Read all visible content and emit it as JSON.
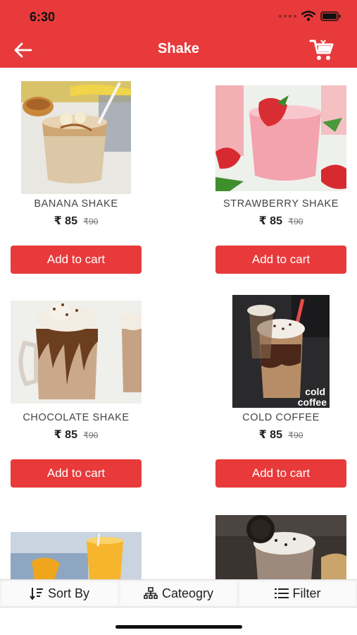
{
  "status": {
    "time": "6:30"
  },
  "header": {
    "title": "Shake"
  },
  "currency": "₹",
  "products": [
    {
      "name": "BANANA SHAKE",
      "price": "85",
      "old_price": "90",
      "button": "Add to cart"
    },
    {
      "name": "STRAWBERRY SHAKE",
      "price": "85",
      "old_price": "90",
      "button": "Add to cart"
    },
    {
      "name": "CHOCOLATE SHAKE",
      "price": "85",
      "old_price": "90",
      "button": "Add to cart"
    },
    {
      "name": "COLD COFFEE",
      "price": "85",
      "old_price": "90",
      "button": "Add to cart",
      "image_text": [
        "cold",
        "coffee"
      ]
    }
  ],
  "bottom_bar": {
    "sort": "Sort By",
    "category": "Cateogry",
    "filter": "Filter"
  },
  "colors": {
    "accent": "#e83a3b"
  },
  "icons": {
    "back": "arrow-left-icon",
    "cart": "cart-icon",
    "sort": "sort-icon",
    "category": "sitemap-icon",
    "filter": "list-icon"
  }
}
